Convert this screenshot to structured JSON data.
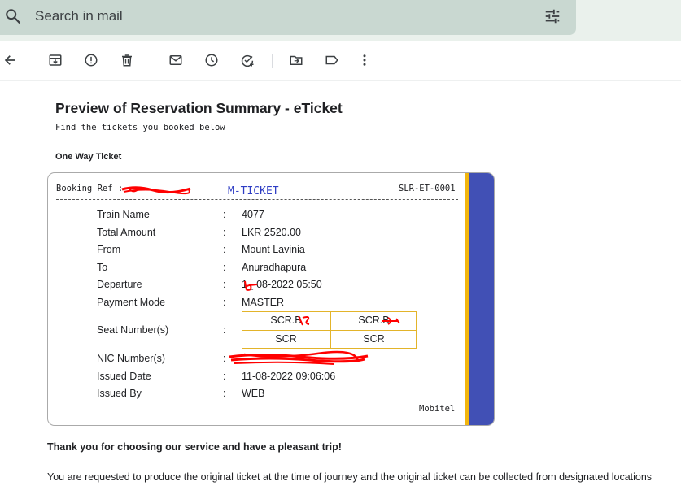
{
  "search": {
    "placeholder": "Search in mail",
    "icon": "search-icon",
    "options_icon": "tune-icon"
  },
  "toolbar": {
    "icons": [
      "back-arrow-icon",
      "archive-icon",
      "report-spam-icon",
      "delete-icon",
      "mark-unread-icon",
      "snooze-icon",
      "add-task-icon",
      "move-to-icon",
      "label-icon",
      "more-vert-icon"
    ]
  },
  "email": {
    "title": "Preview of Reservation Summary - eTicket",
    "subtitle": "Find the tickets you booked below",
    "section": "One Way Ticket",
    "ticket": {
      "booking_ref_label": "Booking Ref :",
      "type": "M-TICKET",
      "code": "SLR-ET-0001",
      "rows": [
        {
          "label": "Train Name",
          "colon": ":",
          "value": "4077"
        },
        {
          "label": "Total Amount",
          "colon": ":",
          "value": "LKR 2520.00"
        },
        {
          "label": "From",
          "colon": ":",
          "value": "Mount Lavinia"
        },
        {
          "label": "To",
          "colon": ":",
          "value": "Anuradhapura"
        },
        {
          "label": "Departure",
          "colon": ":",
          "value": "1_-08-2022 05:50"
        },
        {
          "label": "Payment Mode",
          "colon": ":",
          "value": "MASTER"
        }
      ],
      "seat_label": "Seat Number(s)",
      "seat_colon": ":",
      "seats": [
        {
          "number": "SCR.B",
          "class": "SCR"
        },
        {
          "number": "SCR.B",
          "class": "SCR"
        }
      ],
      "rows_after": [
        {
          "label": "NIC Number(s)",
          "colon": ":",
          "value": ""
        },
        {
          "label": "Issued Date",
          "colon": ":",
          "value": "11-08-2022 09:06:06"
        },
        {
          "label": "Issued By",
          "colon": ":",
          "value": "WEB"
        }
      ],
      "provider": "Mobitel"
    },
    "thanks": "Thank you for choosing our service and have a pleasant trip!",
    "notice": "You are requested to produce the original ticket at the time of journey and the original ticket can be collected from designated locations"
  },
  "colors": {
    "search_bg": "#c9d8d1",
    "ticket_stripe_yellow": "#f2b60e",
    "ticket_stripe_blue": "#4150b5",
    "mticket_text": "#2e3dc4",
    "redaction": "#ff0000"
  }
}
